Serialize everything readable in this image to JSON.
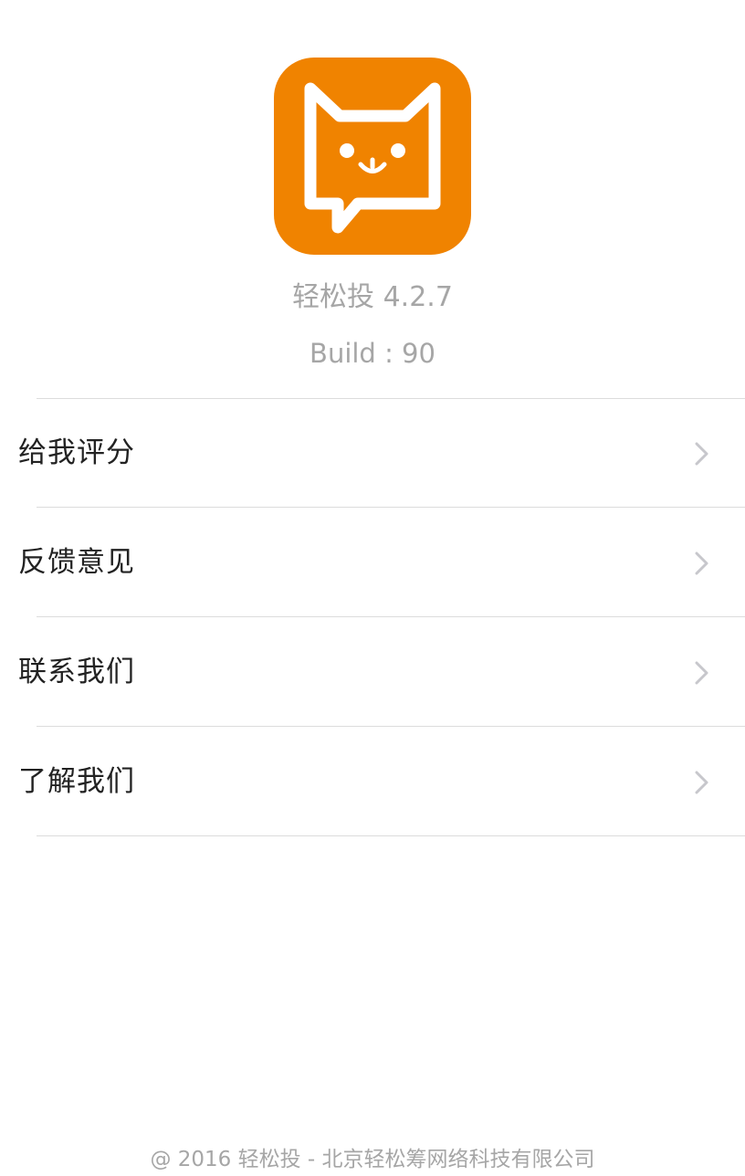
{
  "app": {
    "icon": "cat-chat-bubble-logo",
    "icon_color": "#F08300",
    "name_version": "轻松投 4.2.7",
    "build": "Build : 90"
  },
  "menu": {
    "items": [
      {
        "label": "给我评分",
        "icon": "chevron-right-icon"
      },
      {
        "label": "反馈意见",
        "icon": "chevron-right-icon"
      },
      {
        "label": "联系我们",
        "icon": "chevron-right-icon"
      },
      {
        "label": "了解我们",
        "icon": "chevron-right-icon"
      }
    ]
  },
  "footer": {
    "copyright": "@ 2016 轻松投 - 北京轻松筹网络科技有限公司"
  }
}
